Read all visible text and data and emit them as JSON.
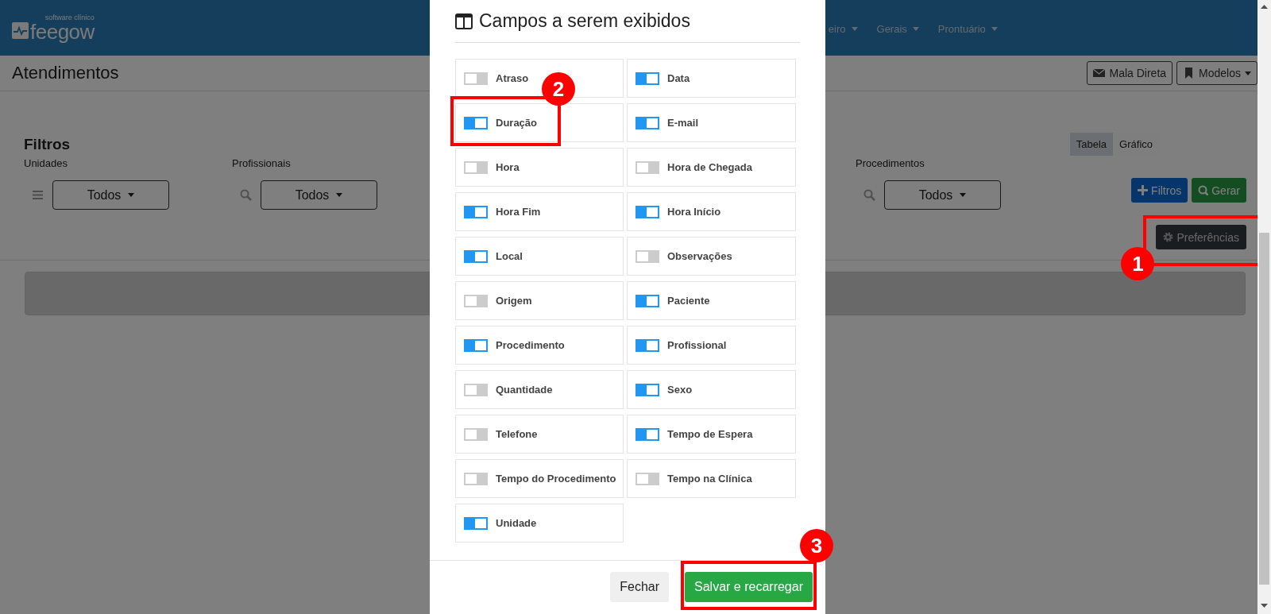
{
  "navbar": {
    "logo": {
      "tagline": "software clínico",
      "name": "feegow"
    },
    "menu": [
      {
        "label": "eiro"
      },
      {
        "label": "Gerais"
      },
      {
        "label": "Prontuário"
      }
    ]
  },
  "page_header": {
    "title": "Atendimentos",
    "buttons": [
      {
        "label": "Mala Direta"
      },
      {
        "label": "Modelos"
      }
    ]
  },
  "filters": {
    "title": "Filtros",
    "groups": [
      {
        "label": "Unidades",
        "value": "Todos"
      },
      {
        "label": "Profissionais",
        "value": "Todos"
      },
      {
        "label": "Procedimentos",
        "value": "Todos"
      }
    ],
    "view_tabs": [
      {
        "label": "Tabela",
        "selected": true
      },
      {
        "label": "Gráfico",
        "selected": false
      }
    ],
    "actions": [
      {
        "label": "Filtros"
      },
      {
        "label": "Gerar"
      }
    ],
    "preferences_button": {
      "label": "Preferências",
      "callout": "1"
    }
  },
  "modal": {
    "title": "Campos a serem exibidos",
    "fields": [
      {
        "label": "Atraso",
        "on": false
      },
      {
        "label": "Data",
        "on": true
      },
      {
        "label": "Duração",
        "on": true,
        "callout": "2"
      },
      {
        "label": "E-mail",
        "on": true
      },
      {
        "label": "Hora",
        "on": false
      },
      {
        "label": "Hora de Chegada",
        "on": false
      },
      {
        "label": "Hora Fim",
        "on": true
      },
      {
        "label": "Hora Início",
        "on": true
      },
      {
        "label": "Local",
        "on": true
      },
      {
        "label": "Observações",
        "on": false
      },
      {
        "label": "Origem",
        "on": false
      },
      {
        "label": "Paciente",
        "on": true
      },
      {
        "label": "Procedimento",
        "on": true
      },
      {
        "label": "Profissional",
        "on": true
      },
      {
        "label": "Quantidade",
        "on": false
      },
      {
        "label": "Sexo",
        "on": true
      },
      {
        "label": "Telefone",
        "on": false
      },
      {
        "label": "Tempo de Espera",
        "on": true
      },
      {
        "label": "Tempo do Procedimento",
        "on": false
      },
      {
        "label": "Tempo na Clínica",
        "on": false
      },
      {
        "label": "Unidade",
        "on": true
      }
    ],
    "buttons": [
      {
        "label": "Fechar",
        "kind": "secondary"
      },
      {
        "label": "Salvar e recarregar",
        "kind": "primary",
        "callout": "3"
      }
    ]
  }
}
